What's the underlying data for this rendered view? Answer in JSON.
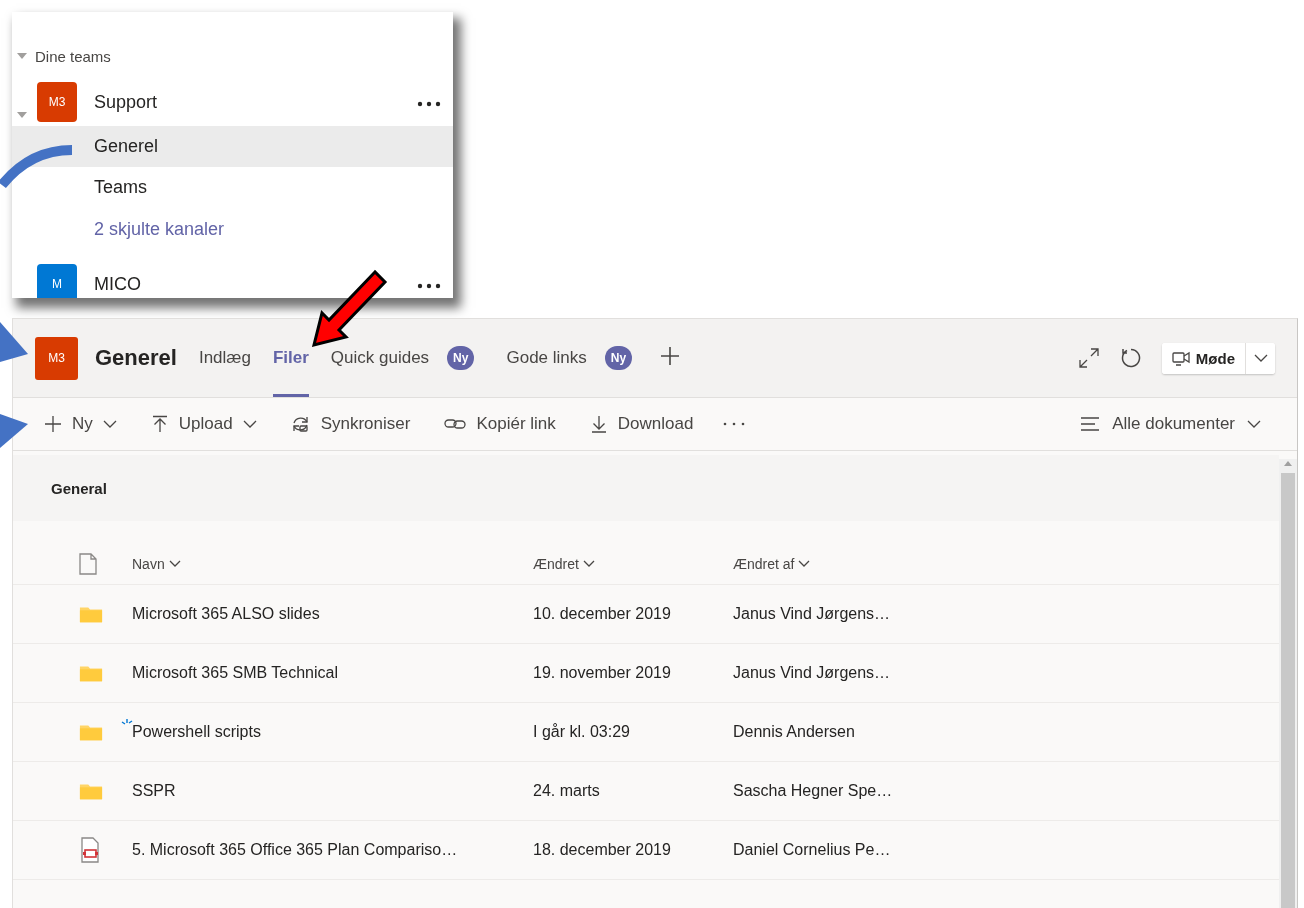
{
  "teams_panel": {
    "section": "Dine teams",
    "teams": [
      {
        "avatar": "M3",
        "name": "Support",
        "color": "#d83b01",
        "channels": [
          {
            "name": "Generel",
            "selected": true
          },
          {
            "name": "Teams",
            "selected": false
          }
        ],
        "hidden_link": "2 skjulte kanaler"
      },
      {
        "avatar": "M",
        "name": "MICO",
        "color": "#0078d4"
      }
    ]
  },
  "channel_window": {
    "avatar": "M3",
    "title": "Generel",
    "tabs": [
      {
        "label": "Indlæg",
        "selected": false
      },
      {
        "label": "Filer",
        "selected": true
      },
      {
        "label": "Quick guides",
        "selected": false,
        "badge": "Ny"
      },
      {
        "label": "Gode links",
        "selected": false,
        "badge": "Ny"
      }
    ],
    "meeting_button": "Møde",
    "toolbar": [
      {
        "kind": "new",
        "label": "Ny",
        "dropdown": true
      },
      {
        "kind": "upload",
        "label": "Upload",
        "dropdown": true
      },
      {
        "kind": "sync",
        "label": "Synkroniser",
        "dropdown": false
      },
      {
        "kind": "link",
        "label": "Kopiér link",
        "dropdown": false
      },
      {
        "kind": "download",
        "label": "Download",
        "dropdown": false
      }
    ],
    "view": "Alle dokumenter",
    "library": {
      "title": "General",
      "columns": [
        "Navn",
        "Ændret",
        "Ændret af"
      ],
      "rows": [
        {
          "kind": "folder",
          "name": "Microsoft 365 ALSO slides",
          "modified": "10. december 2019",
          "modified_by": "Janus Vind Jørgens…",
          "new": false
        },
        {
          "kind": "folder",
          "name": "Microsoft 365 SMB Technical",
          "modified": "19. november 2019",
          "modified_by": "Janus Vind Jørgens…",
          "new": false
        },
        {
          "kind": "folder",
          "name": "Powershell scripts",
          "modified": "I går kl. 03:29",
          "modified_by": "Dennis Andersen",
          "new": true
        },
        {
          "kind": "folder",
          "name": "SSPR",
          "modified": "24. marts",
          "modified_by": "Sascha Hegner Spe…",
          "new": false
        },
        {
          "kind": "pdf",
          "name": "5. Microsoft 365 Office 365 Plan Compariso…",
          "modified": "18. december 2019",
          "modified_by": "Daniel Cornelius Pe…",
          "new": false
        }
      ]
    }
  }
}
